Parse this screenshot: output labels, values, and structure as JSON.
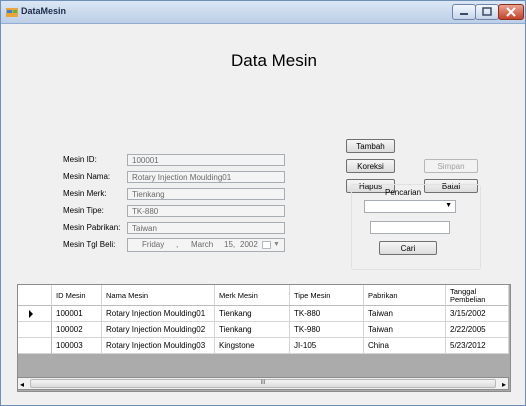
{
  "window": {
    "title": "DataMesin"
  },
  "form": {
    "title": "Data Mesin"
  },
  "fields": [
    {
      "label": "Mesin ID:",
      "value": "100001"
    },
    {
      "label": "Mesin Nama:",
      "value": "Rotary Injection Moulding01"
    },
    {
      "label": "Mesin Merk:",
      "value": "Tienkang"
    },
    {
      "label": "Mesin Tipe:",
      "value": "TK-880"
    },
    {
      "label": "Mesin Pabrikan:",
      "value": "Taiwan"
    },
    {
      "label": "Mesin Tgl Beli:"
    }
  ],
  "date_picker": {
    "day_name": "Friday",
    "sep1": ",",
    "month": "March",
    "day": "15,",
    "year": "2002"
  },
  "buttons": {
    "tambah": "Tambah",
    "koreksi": "Koreksi",
    "hapus": "Hapus",
    "simpan": "Simpan",
    "batal": "Batal"
  },
  "search": {
    "title": "Pencarian",
    "combo_value": "",
    "input_value": "",
    "button": "Cari"
  },
  "grid": {
    "columns": [
      "ID Mesin",
      "Nama Mesin",
      "Merk Mesin",
      "Tipe Mesin",
      "Pabrikan",
      "Tanggal Pembelian"
    ],
    "rows": [
      [
        "100001",
        "Rotary Injection Moulding01",
        "Tienkang",
        "TK-880",
        "Taiwan",
        "3/15/2002"
      ],
      [
        "100002",
        "Rotary Injection Moulding02",
        "Tienkang",
        "TK-980",
        "Taiwan",
        "2/22/2005"
      ],
      [
        "100003",
        "Rotary Injection Moulding03",
        "Kingstone",
        "JI-105",
        "China",
        "5/23/2012"
      ]
    ],
    "scroll_grip": "III"
  }
}
